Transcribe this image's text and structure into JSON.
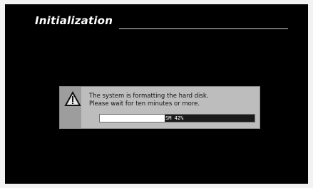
{
  "screen": {
    "title": "Initialization"
  },
  "dialog": {
    "icon": "warning-icon",
    "message_line1": "The system is formatting the hard disk.",
    "message_line2": "Please wait for ten minutes or more.",
    "progress": {
      "label": "SM 42%",
      "fraction": 0.42
    }
  },
  "colors": {
    "screen_background": "#000000",
    "dialog_background": "#bdbdbd",
    "progress_fill": "#ffffff",
    "progress_track": "#1a1a1a"
  }
}
